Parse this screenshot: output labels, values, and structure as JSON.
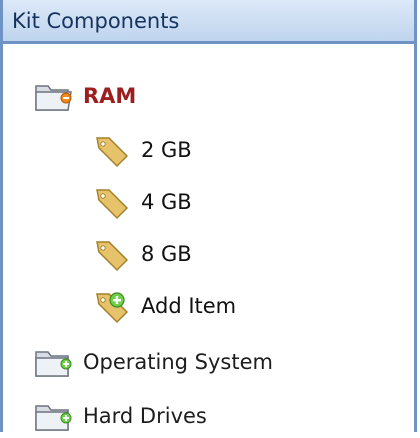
{
  "panel": {
    "title": "Kit Components"
  },
  "tree": {
    "category": {
      "label": "RAM",
      "icon": "folder-open-icon"
    },
    "items": [
      {
        "label": "2 GB",
        "icon": "tag-icon"
      },
      {
        "label": "4 GB",
        "icon": "tag-icon"
      },
      {
        "label": "8 GB",
        "icon": "tag-icon"
      }
    ],
    "add_item": {
      "label": "Add Item",
      "icon": "tag-add-icon"
    },
    "other_categories": [
      {
        "label": "Operating System",
        "icon": "folder-closed-icon"
      },
      {
        "label": "Hard Drives",
        "icon": "folder-closed-icon"
      }
    ]
  },
  "colors": {
    "header_border": "#6f93c4",
    "category_open": "#9c1f1f"
  }
}
